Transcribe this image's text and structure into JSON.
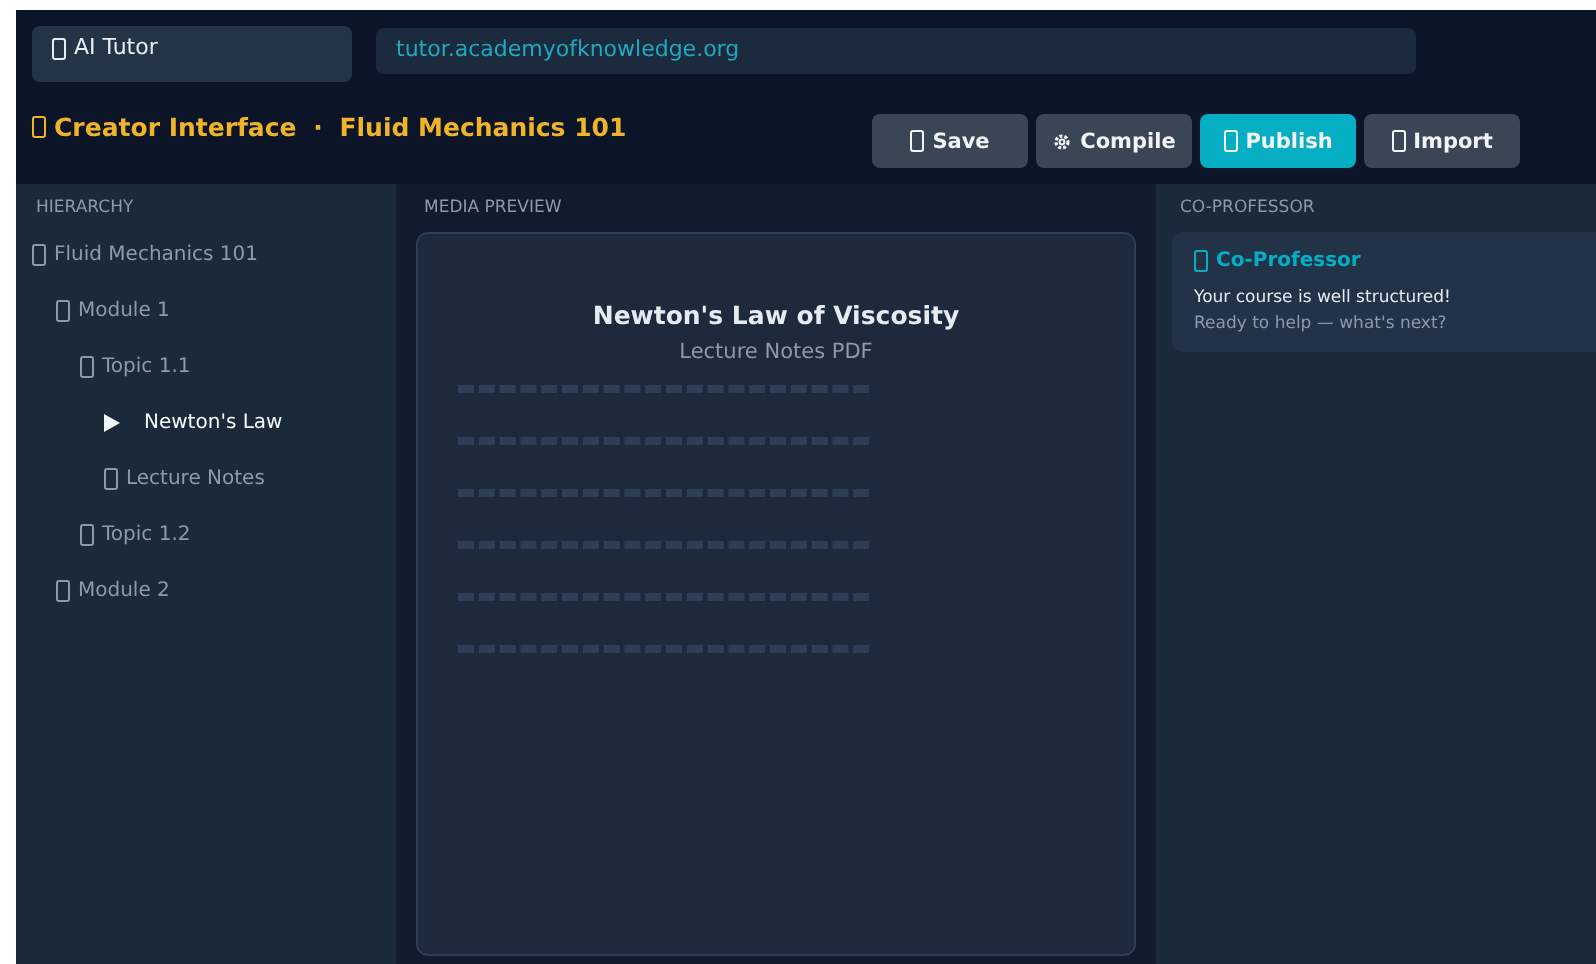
{
  "app_badge": {
    "label": "AI Tutor"
  },
  "address_bar": {
    "value": "tutor.academyofknowledge.org"
  },
  "header_title": {
    "section": "Creator Interface",
    "separator": "·",
    "course": "Fluid Mechanics 101"
  },
  "toolbar": [
    {
      "label": "Save",
      "kind": "box",
      "primary": false
    },
    {
      "label": "Compile",
      "kind": "gear",
      "primary": false
    },
    {
      "label": "Publish",
      "kind": "box",
      "primary": true
    },
    {
      "label": "Import",
      "kind": "box",
      "primary": false
    }
  ],
  "hierarchy": {
    "title": "HIERARCHY",
    "items": [
      {
        "label": "Fluid Mechanics 101",
        "selected": false,
        "children": [
          {
            "label": "Module 1",
            "selected": false,
            "children": [
              {
                "label": "Topic 1.1",
                "selected": false,
                "children": [
                  {
                    "label": "Newton's Law",
                    "selected": true
                  },
                  {
                    "label": "Lecture Notes",
                    "selected": false
                  }
                ]
              },
              {
                "label": "Topic 1.2",
                "selected": false
              }
            ]
          },
          {
            "label": "Module 2",
            "selected": false
          }
        ]
      }
    ]
  },
  "media_preview": {
    "title": "MEDIA PREVIEW",
    "document_title": "Newton's Law of Viscosity",
    "document_type": "Lecture Notes PDF"
  },
  "co_professor": {
    "title": "CO-PROFESSOR",
    "card_title": "Co-Professor",
    "messages": [
      "Your course is well structured!",
      "Ready to help — what's next?"
    ]
  }
}
